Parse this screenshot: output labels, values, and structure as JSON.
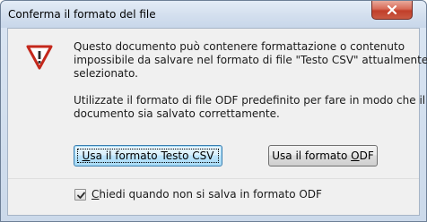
{
  "window": {
    "title": "Conferma il formato del file"
  },
  "icons": {
    "close": "close-icon",
    "warning": "warning-icon",
    "check": "checkmark-icon"
  },
  "message": {
    "lines": [
      "Questo documento può contenere formattazione o contenuto",
      "impossibile da salvare nel formato di file \"Testo CSV\" attualmente",
      "selezionato.",
      "Utilizzate il formato di file ODF predefinito per fare in modo che il",
      "documento sia salvato correttamente."
    ]
  },
  "buttons": {
    "keep_format": {
      "prefix": "",
      "accel": "U",
      "rest": "sa il formato Testo CSV"
    },
    "use_odf": {
      "prefix": "Usa il formato ",
      "accel": "O",
      "rest": "DF"
    }
  },
  "checkbox": {
    "checked": true,
    "accel": "C",
    "rest": "hiedi quando non si salva in formato ODF"
  },
  "colors": {
    "warning_red": "#c4281c",
    "close_button": "#c95a43"
  }
}
